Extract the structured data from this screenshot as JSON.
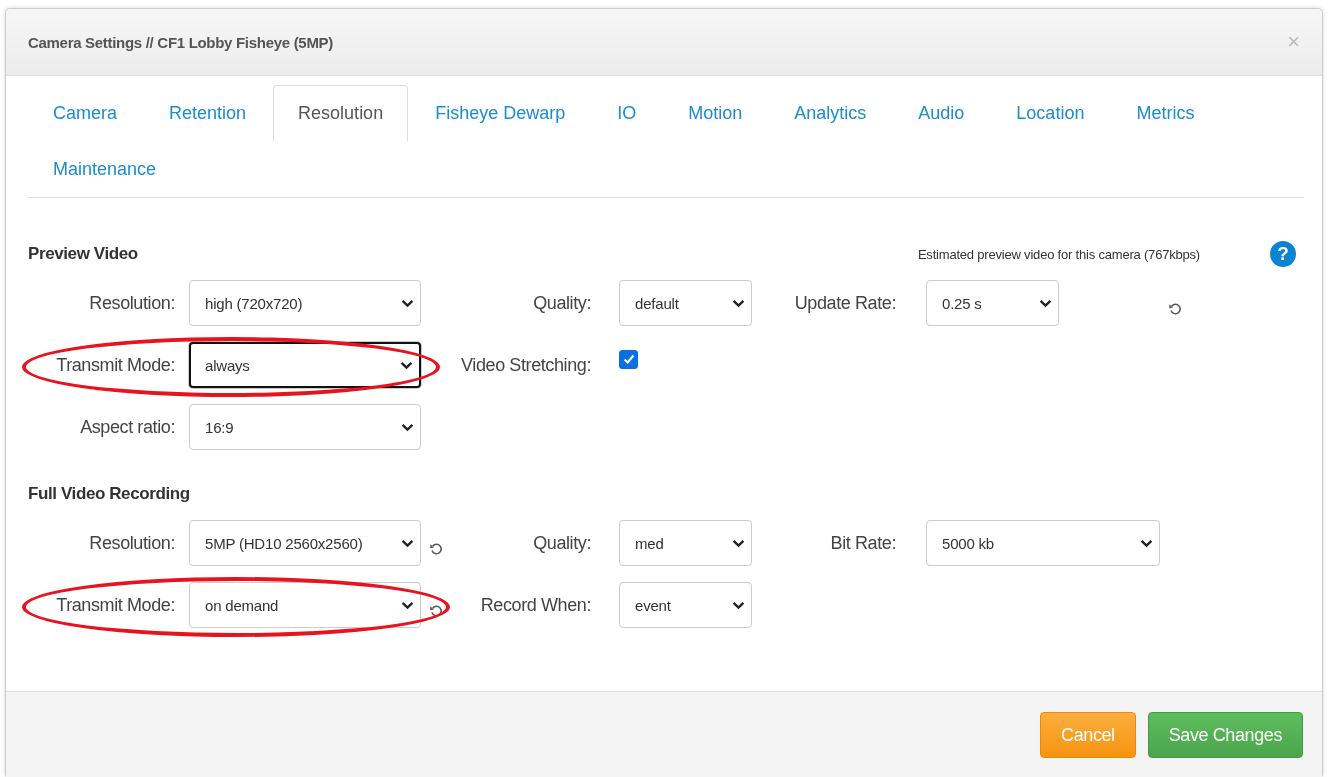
{
  "dialog": {
    "title": "Camera Settings // CF1 Lobby Fisheye (5MP)",
    "close": "×"
  },
  "tabs": [
    {
      "label": "Camera",
      "selected": false
    },
    {
      "label": "Retention",
      "selected": false
    },
    {
      "label": "Resolution",
      "selected": true
    },
    {
      "label": "Fisheye Dewarp",
      "selected": false
    },
    {
      "label": "IO",
      "selected": false
    },
    {
      "label": "Motion",
      "selected": false
    },
    {
      "label": "Analytics",
      "selected": false
    },
    {
      "label": "Audio",
      "selected": false
    },
    {
      "label": "Location",
      "selected": false
    },
    {
      "label": "Metrics",
      "selected": false
    },
    {
      "label": "Maintenance",
      "selected": false
    }
  ],
  "sections": [
    {
      "title": "Preview Video",
      "note": "Estimated preview video for this camera (767kbps)",
      "help": "?",
      "rows": [
        [
          {
            "kind": "select",
            "label": "Resolution:",
            "value": "high (720x720)"
          },
          {
            "kind": "select",
            "label": "Quality:",
            "value": "default"
          },
          {
            "kind": "select",
            "label": "Update Rate:",
            "value": "0.25 s",
            "reset": true
          }
        ],
        [
          {
            "kind": "select",
            "label": "Transmit Mode:",
            "value": "always",
            "focused": true,
            "highlighted": true
          },
          {
            "kind": "checkbox",
            "label": "Video Stretching:",
            "checked": true
          }
        ],
        [
          {
            "kind": "select",
            "label": "Aspect ratio:",
            "value": "16:9"
          }
        ]
      ]
    },
    {
      "title": "Full Video Recording",
      "rows": [
        [
          {
            "kind": "select",
            "label": "Resolution:",
            "value": "5MP (HD10 2560x2560)",
            "reset": true
          },
          {
            "kind": "select",
            "label": "Quality:",
            "value": "med"
          },
          {
            "kind": "select",
            "label": "Bit Rate:",
            "value": "5000 kb"
          }
        ],
        [
          {
            "kind": "select",
            "label": "Transmit Mode:",
            "value": "on demand",
            "reset": true,
            "highlighted": true
          },
          {
            "kind": "select",
            "label": "Record When:",
            "value": "event"
          }
        ]
      ]
    }
  ],
  "buttons": [
    {
      "label": "Cancel",
      "kind": "cancel"
    },
    {
      "label": "Save Changes",
      "kind": "primary"
    }
  ]
}
